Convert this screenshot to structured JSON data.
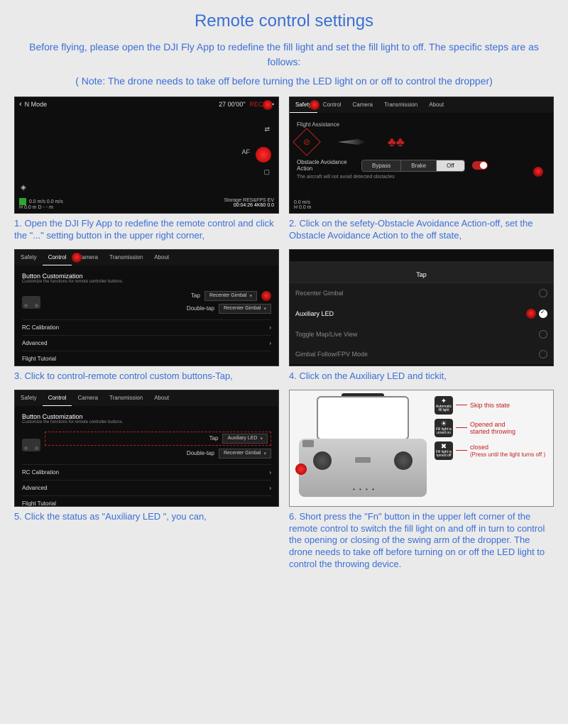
{
  "title": "Remote control settings",
  "intro": "Before flying, please open the DJI Fly App to redefine the fill light and set the fill light to off. The specific steps are as follows:",
  "note": "( Note: The drone needs to take off before turning the LED light on or off to control the dropper)",
  "tabs": {
    "safety": "Safety",
    "control": "Control",
    "camera": "Camera",
    "transmission": "Transmission",
    "about": "About"
  },
  "shot1": {
    "mode": "N Mode",
    "time": "27 00'00\"",
    "rec": "REC",
    "af": "AF",
    "bl1": "0.0 m/s  0.0 m/s",
    "bl2": "H 0.0 m   D - - m",
    "br1": "Storage   RES&FPS  EV",
    "br2": "00:04:26  4K60  0.0"
  },
  "shot2": {
    "flight_assist": "Flight Assistance",
    "oa_label": "Obstacle Avoidance Action",
    "bypass": "Bypass",
    "brake": "Brake",
    "off": "Off",
    "oa_note": "The aircraft will not avoid detected obstacles",
    "bl": "0.0 m/s",
    "bl2": "H 0.0 m"
  },
  "shot3": {
    "h": "Button Customization",
    "sub": "Customize the functions for remote controller buttons.",
    "tap": "Tap",
    "dtap": "Double-tap",
    "recenter": "Recenter Gimbal",
    "rc_cal": "RC Calibration",
    "advanced": "Advanced",
    "tutorial": "Flight Tutorial"
  },
  "shot4": {
    "tap": "Tap",
    "opt1": "Recenter Gimbal",
    "opt2": "Auxiliary LED",
    "opt3": "Toggle Map/Live View",
    "opt4": "Gimbal Follow/FPV Mode"
  },
  "shot5": {
    "aux": "Auxiliary LED"
  },
  "shot6": {
    "i1": "Automatic fill light",
    "i2": "Fill light is urned on",
    "i3": "Fill light is turned off",
    "t1": "Skip this state",
    "t2a": "Opened and",
    "t2b": "started throwing",
    "t3a": "closed",
    "t3b": "(Press until the light turns off )"
  },
  "caps": {
    "c1": "1. Open the DJI Fly App to redefine the remote control and click the \"...\" setting button in the upper right corner,",
    "c2": "2. Click on the sefety-Obstacle Avoidance Action-off, set the Obstacle Avoidance Action to the off state,",
    "c3": "3. Click to control-remote control custom buttons-Tap,",
    "c4": "4. Click on the Auxiliary LED and tickit,",
    "c5": "5. Click the status as \"Auxiliary LED \", you can,",
    "c6": "6. Short press the \"Fn\" button in the upper left corner of the remote control to switch the fill light on and off in turn to control the opening or closing of the swing arm of the dropper. The drone needs to take off before turning on or off the LED light to control the throwing device."
  }
}
